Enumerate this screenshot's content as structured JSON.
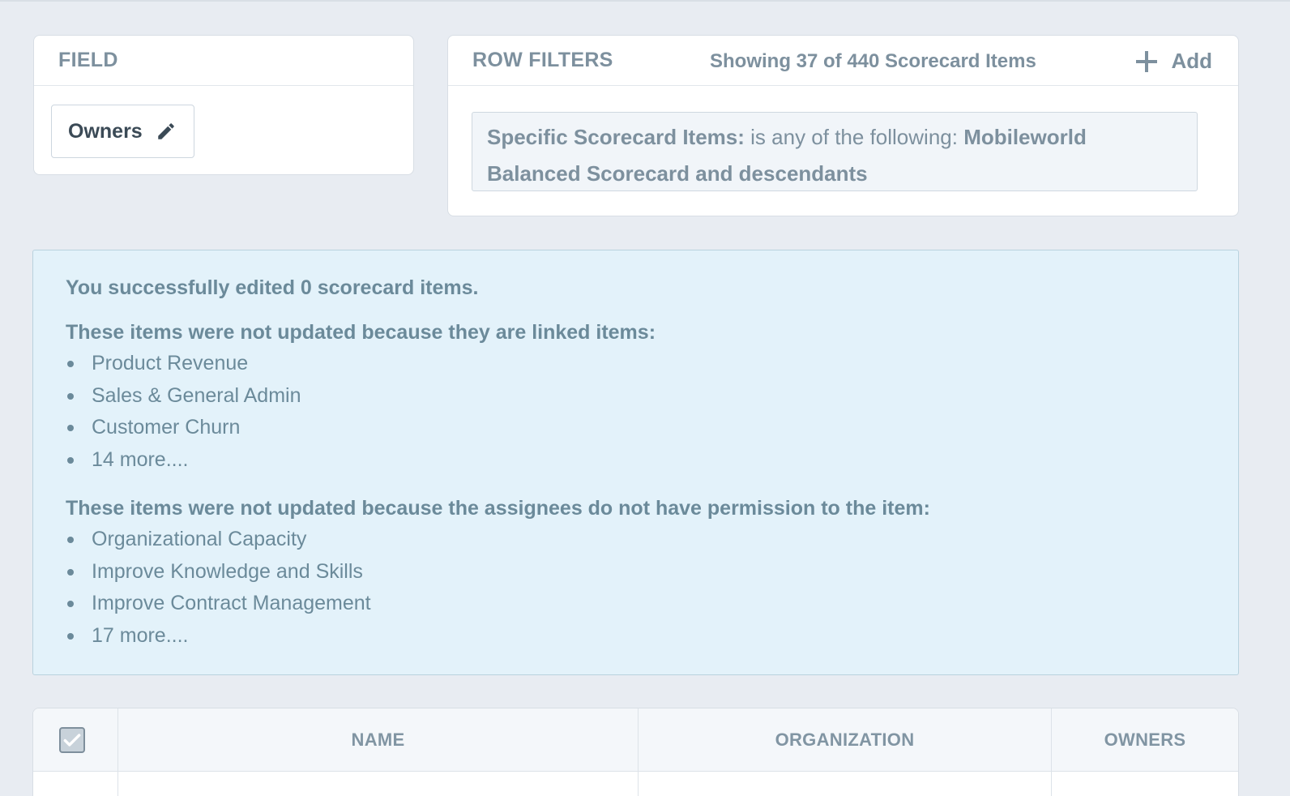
{
  "field_panel": {
    "title": "FIELD",
    "chip_label": "Owners"
  },
  "filters_panel": {
    "title": "ROW FILTERS",
    "showing": "Showing 37 of 440 Scorecard Items",
    "add_label": "Add",
    "filter": {
      "label": "Specific Scorecard Items:",
      "operator": " is any of the following: ",
      "value": "Mobileworld Balanced Scorecard and descendants"
    }
  },
  "alert": {
    "headline": "You successfully edited 0 scorecard items.",
    "linked_title": "These items were not updated because they are linked items:",
    "linked_items": [
      "Product Revenue",
      "Sales & General Admin",
      "Customer Churn",
      "14 more...."
    ],
    "permission_title": "These items were not updated because the assignees do not have permission to the item:",
    "permission_items": [
      "Organizational Capacity",
      "Improve Knowledge and Skills",
      "Improve Contract Management",
      "17 more...."
    ]
  },
  "table": {
    "columns": [
      "NAME",
      "ORGANIZATION",
      "OWNERS"
    ]
  },
  "colors": {
    "background": "#e8ecf2",
    "alert_bg": "#e3f2fa",
    "text_muted": "#7d909e"
  }
}
